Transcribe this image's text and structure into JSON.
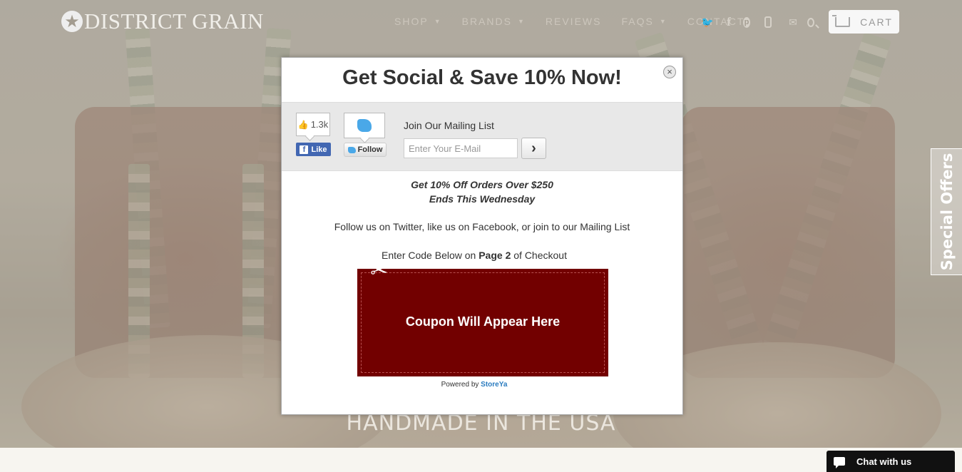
{
  "header": {
    "logo_text": "DISTRICT GRAIN",
    "nav": [
      {
        "label": "SHOP",
        "has_dropdown": true
      },
      {
        "label": "BRANDS",
        "has_dropdown": true
      },
      {
        "label": "REVIEWS",
        "has_dropdown": false
      },
      {
        "label": "FAQS",
        "has_dropdown": true
      },
      {
        "label": "CONTACT",
        "has_dropdown": false
      }
    ],
    "social_icons": [
      "twitter-icon",
      "facebook-icon",
      "pinterest-icon",
      "instagram-icon",
      "mail-icon",
      "search-icon"
    ],
    "cart_label": "CART"
  },
  "hero": {
    "tagline": "HANDMADE IN THE USA"
  },
  "special_tab": {
    "label": "Special Offers"
  },
  "popup": {
    "title": "Get Social & Save 10% Now!",
    "close_symbol": "×",
    "like_count": "1.3k",
    "like_label": "Like",
    "follow_label": "Follow",
    "mailing_label": "Join Our Mailing List",
    "email_placeholder": "Enter Your E-Mail",
    "submit_symbol": "›",
    "offer_line1": "Get 10% Off Orders Over $250",
    "offer_line2": "Ends This Wednesday",
    "follow_text": "Follow us on Twitter, like us on Facebook, or join to our Mailing List",
    "code_prefix": "Enter Code Below on ",
    "code_page": "Page 2",
    "code_suffix": " of Checkout",
    "coupon_text": "Coupon Will Appear Here",
    "powered_prefix": "Powered by ",
    "powered_brand": "StoreYa"
  },
  "chat": {
    "label": "Chat with us"
  },
  "colors": {
    "coupon_bg": "#720000",
    "facebook": "#4267b2",
    "twitter": "#4aa8e8",
    "storeya": "#2a7bbf"
  }
}
